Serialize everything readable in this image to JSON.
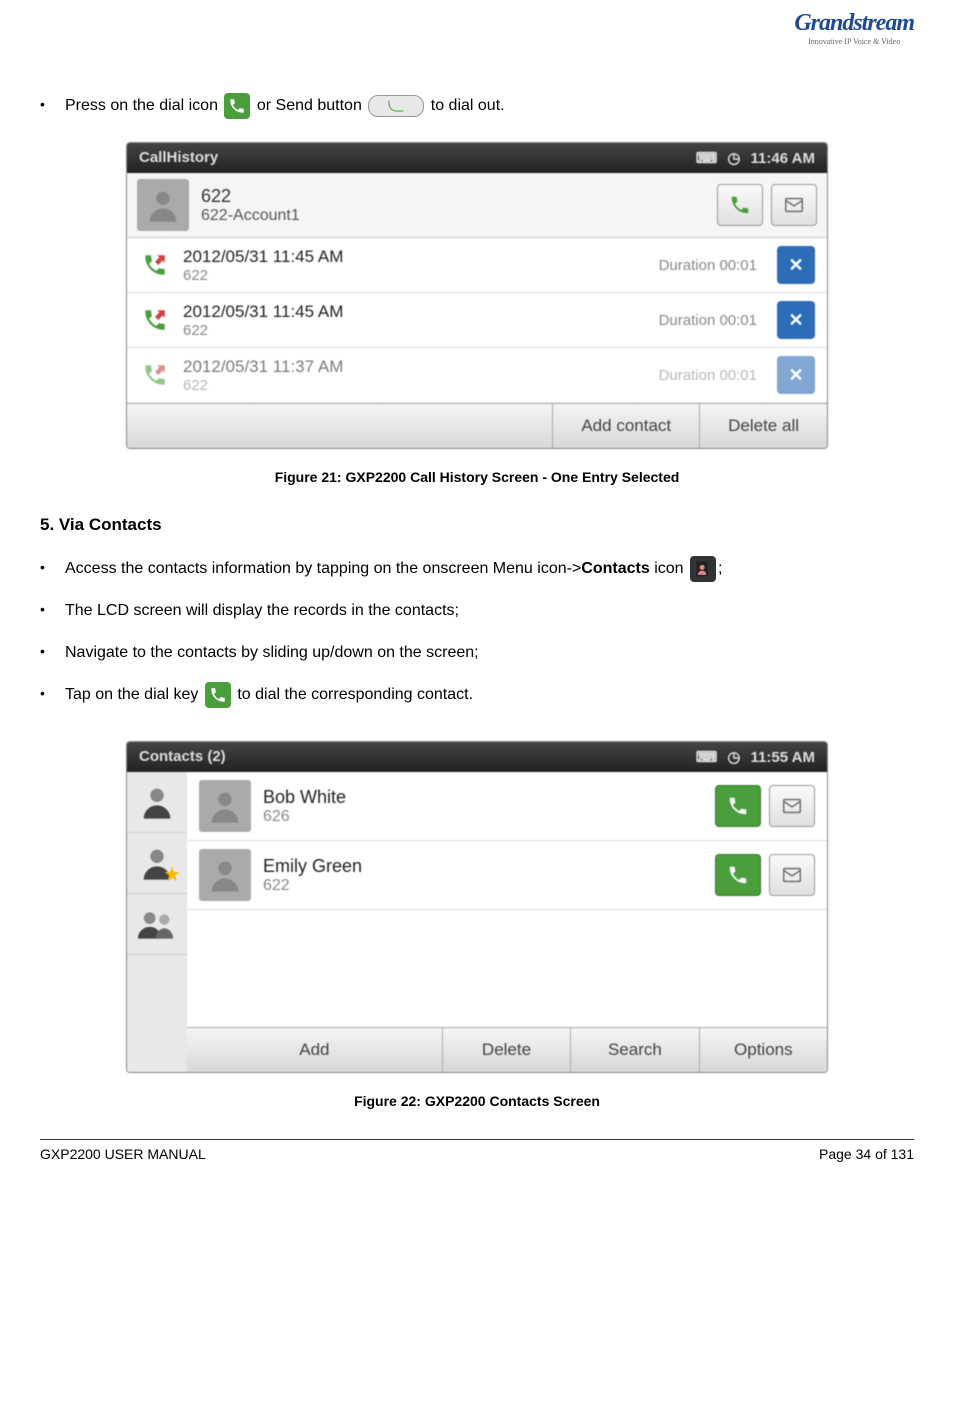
{
  "logo": {
    "text": "Grandstream",
    "tagline": "Innovative IP Voice & Video"
  },
  "bullet1": {
    "prefix": "Press on the dial icon ",
    "mid": " or Send button ",
    "suffix": " to dial out."
  },
  "figure1": {
    "caption": "Figure 21: GXP2200 Call History Screen - One Entry Selected",
    "statusbar": {
      "title": "CallHistory",
      "time": "11:46 AM"
    },
    "selected": {
      "number": "622",
      "account": "622-Account1"
    },
    "calls": [
      {
        "date": "2012/05/31 11:45 AM",
        "number": "622",
        "duration": "Duration 00:01"
      },
      {
        "date": "2012/05/31 11:45 AM",
        "number": "622",
        "duration": "Duration 00:01"
      },
      {
        "date": "2012/05/31 11:37 AM",
        "number": "622",
        "duration": "Duration 00:01"
      }
    ],
    "buttons": {
      "add_contact": "Add contact",
      "delete_all": "Delete all"
    }
  },
  "section5": {
    "heading": "5. Via Contacts",
    "items": {
      "b1_prefix": "Access the contacts information by tapping on the onscreen Menu icon->",
      "b1_bold": "Contacts",
      "b1_mid": " icon ",
      "b1_suffix": ";",
      "b2": "The LCD screen will display the records in the contacts;",
      "b3": "Navigate to the contacts by sliding up/down on the screen;",
      "b4_prefix": "Tap on the dial key ",
      "b4_suffix": " to dial the corresponding contact."
    }
  },
  "figure2": {
    "caption": "Figure 22: GXP2200 Contacts Screen",
    "statusbar": {
      "title": "Contacts (2)",
      "time": "11:55 AM"
    },
    "contacts": [
      {
        "name": "Bob White",
        "number": "626"
      },
      {
        "name": "Emily Green",
        "number": "622"
      }
    ],
    "buttons": {
      "add": "Add",
      "delete": "Delete",
      "search": "Search",
      "options": "Options"
    }
  },
  "footer": {
    "left": "GXP2200 USER MANUAL",
    "right": "Page 34 of 131"
  }
}
